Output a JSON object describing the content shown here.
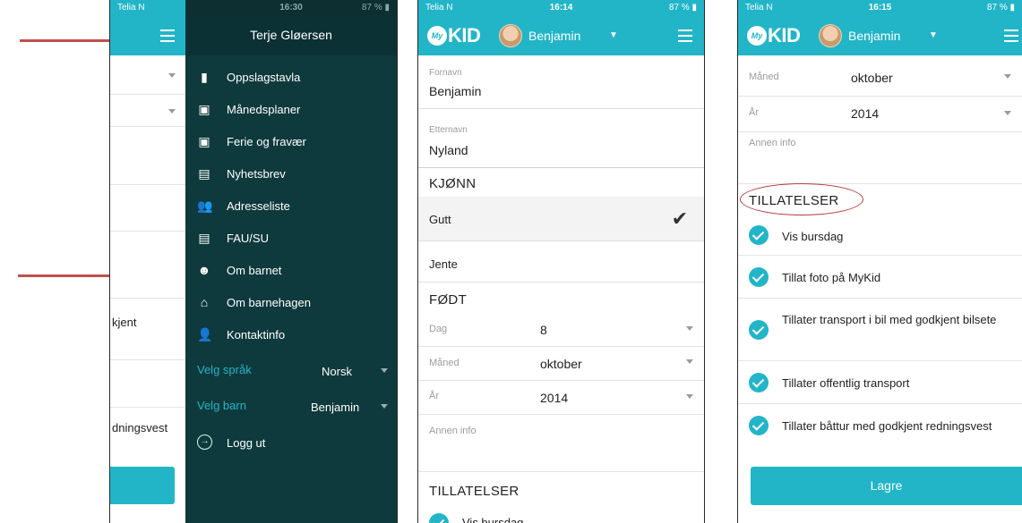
{
  "panel1": {
    "status_left": "Telia N",
    "partial_texts": {
      "row_godkjent": "kjent",
      "row_redningsvest": "dningsvest"
    }
  },
  "menu_panel": {
    "status_time": "16:30",
    "status_right": "87 %",
    "user_name": "Terje Gløersen",
    "items": [
      {
        "label": "Oppslagstavla",
        "icon": "bookmark-icon",
        "glyph": "▮"
      },
      {
        "label": "Månedsplaner",
        "icon": "calendar-icon",
        "glyph": "▣"
      },
      {
        "label": "Ferie og fravær",
        "icon": "calendar-icon",
        "glyph": "▣"
      },
      {
        "label": "Nyhetsbrev",
        "icon": "newsletter-icon",
        "glyph": "▤"
      },
      {
        "label": "Adresseliste",
        "icon": "people-icon",
        "glyph": "👥"
      },
      {
        "label": "FAU/SU",
        "icon": "document-icon",
        "glyph": "▤"
      },
      {
        "label": "Om barnet",
        "icon": "child-icon",
        "glyph": "☻"
      },
      {
        "label": "Om barnehagen",
        "icon": "home-icon",
        "glyph": "⌂"
      },
      {
        "label": "Kontaktinfo",
        "icon": "person-icon",
        "glyph": "👤"
      }
    ],
    "language_label": "Velg språk",
    "language_value": "Norsk",
    "child_label": "Velg barn",
    "child_value": "Benjamin",
    "logout_label": "Logg ut"
  },
  "panel3": {
    "status_left": "Telia N",
    "status_time": "16:14",
    "status_right": "87 %",
    "logo_badge": "My",
    "logo_word": "KID",
    "child_name": "Benjamin",
    "first_name_label": "Fornavn",
    "first_name_value": "Benjamin",
    "last_name_label": "Etternavn",
    "last_name_value": "Nyland",
    "gender_header": "KJØNN",
    "gender_options": [
      "Gutt",
      "Jente"
    ],
    "gender_selected": "Gutt",
    "born_header": "FØDT",
    "day_label": "Dag",
    "day_value": "8",
    "month_label": "Måned",
    "month_value": "oktober",
    "year_label": "År",
    "year_value": "2014",
    "other_info_label": "Annen info",
    "permissions_header": "TILLATELSER",
    "first_permission": "Vis bursdag"
  },
  "panel4": {
    "status_left": "Telia N",
    "status_time": "16:15",
    "status_right": "87 %",
    "logo_badge": "My",
    "logo_word": "KID",
    "child_name": "Benjamin",
    "month_label": "Måned",
    "month_value": "oktober",
    "year_label": "År",
    "year_value": "2014",
    "other_info_label": "Annen info",
    "permissions_header": "TILLATELSER",
    "permissions": [
      "Vis bursdag",
      "Tillat foto på MyKid",
      "Tillater transport i bil med godkjent bilsete",
      "Tillater offentlig transport",
      "Tillater båttur med godkjent redningsvest"
    ],
    "save_label": "Lagre"
  },
  "colors": {
    "accent": "#22b5c8",
    "menu_bg": "#0f3a3d",
    "arrow": "#c0504d",
    "highlight_circle": "#b23a3a"
  }
}
